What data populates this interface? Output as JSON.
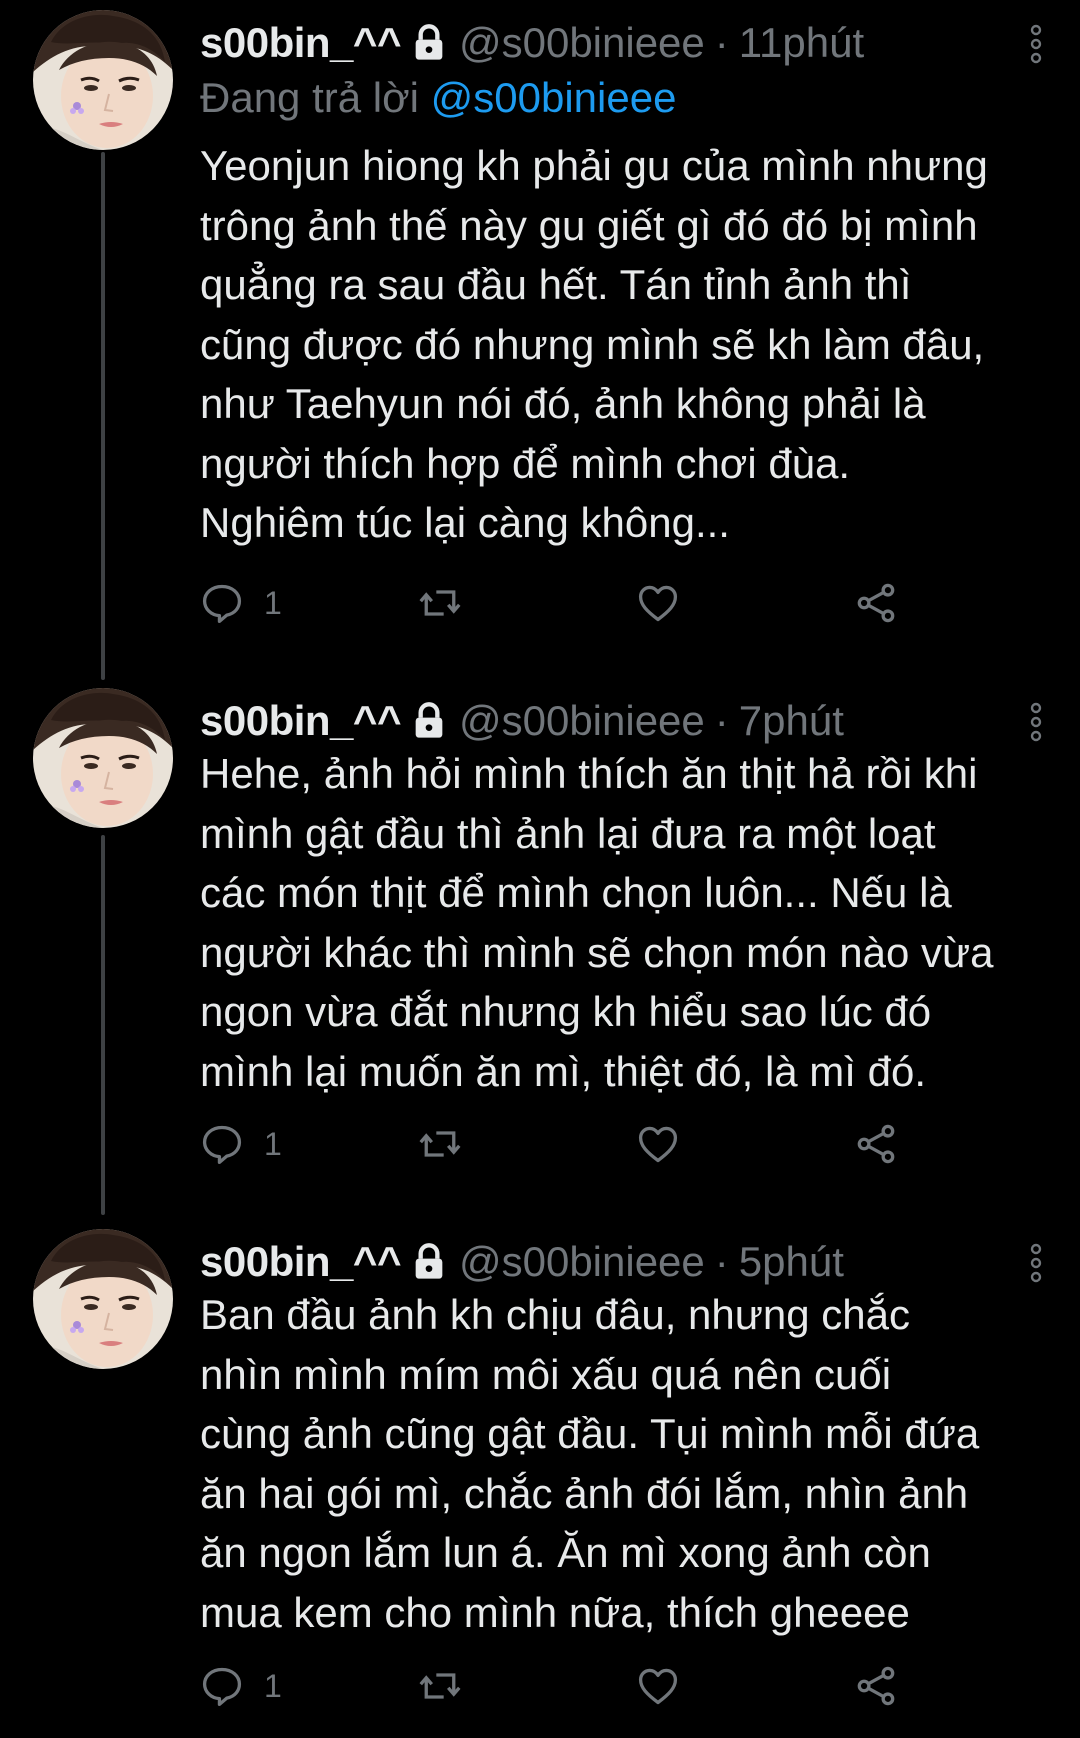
{
  "colors": {
    "background": "#000000",
    "text": "#e7e9ea",
    "muted": "#71767b",
    "link": "#1d9bf0",
    "thread_line": "#3e4144"
  },
  "tweets": [
    {
      "display_name": "s00bin_^^",
      "handle": "@s00binieee",
      "separator": "·",
      "time": "11phút",
      "reply_prefix": "Đang trả lời",
      "reply_to": "@s00binieee",
      "text": "Yeonjun hiong kh phải gu của mình nhưng\ntrông ảnh thế này gu giết gì đó đó bị mình\nquẳng ra sau đầu hết. Tán tỉnh ảnh thì\ncũng được đó nhưng mình sẽ kh làm đâu,\nnhư Taehyun nói đó, ảnh không phải là\nngười thích hợp để mình chơi đùa.\nNghiêm túc lại càng không...",
      "reply_count": "1",
      "icons": [
        "reply-icon",
        "retweet-icon",
        "like-icon",
        "share-icon"
      ]
    },
    {
      "display_name": "s00bin_^^",
      "handle": "@s00binieee",
      "separator": "·",
      "time": "7phút",
      "text": "Hehe, ảnh hỏi mình thích ăn thịt hả rồi khi\nmình gật đầu thì ảnh lại đưa ra một loạt\ncác món thịt để mình chọn luôn... Nếu là\nngười khác thì mình sẽ chọn món nào vừa\nngon vừa đắt nhưng kh hiểu sao lúc đó\nmình lại muốn ăn mì, thiệt đó, là mì đó.",
      "reply_count": "1",
      "icons": [
        "reply-icon",
        "retweet-icon",
        "like-icon",
        "share-icon"
      ]
    },
    {
      "display_name": "s00bin_^^",
      "handle": "@s00binieee",
      "separator": "·",
      "time": "5phút",
      "text": "Ban đầu ảnh kh chịu đâu, nhưng chắc\nnhìn mình mím môi xấu quá nên cuối\ncùng ảnh cũng gật đầu. Tụi mình mỗi đứa\năn hai gói mì, chắc ảnh đói lắm, nhìn ảnh\năn ngon lắm lun á. Ăn mì xong ảnh còn\nmua kem cho mình nữa, thích gheeee",
      "reply_count": "1",
      "icons": [
        "reply-icon",
        "retweet-icon",
        "like-icon",
        "share-icon"
      ]
    }
  ]
}
